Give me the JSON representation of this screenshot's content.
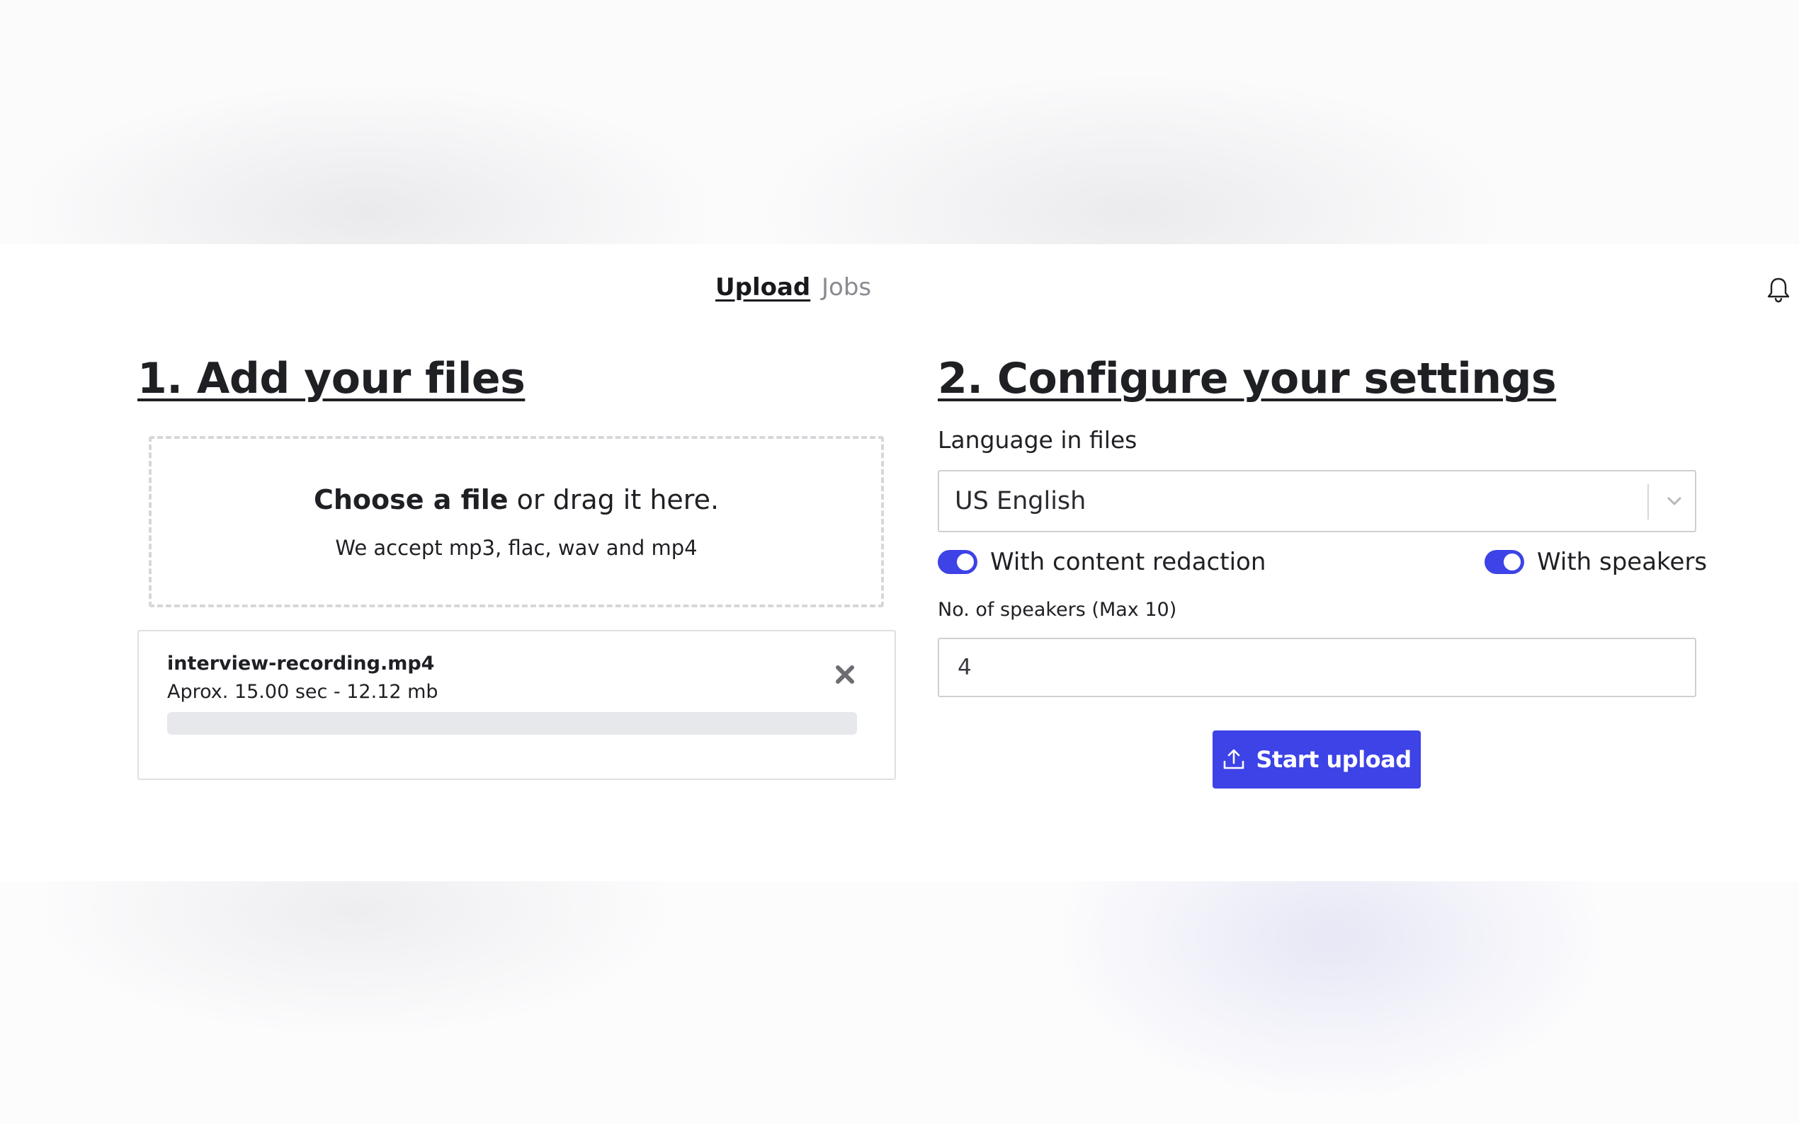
{
  "nav": {
    "tabs": [
      {
        "label": "Upload",
        "active": true
      },
      {
        "label": "Jobs",
        "active": false
      }
    ],
    "notifications_icon": "bell-icon"
  },
  "upload_section": {
    "title": "1. Add your files",
    "dropzone": {
      "choose_label": "Choose a file",
      "drag_label": " or drag it here.",
      "accepted_formats": "We accept mp3, flac, wav and mp4"
    },
    "files": [
      {
        "name": "interview-recording.mp4",
        "meta": "Aprox. 15.00 sec - 12.12 mb",
        "progress": 0
      }
    ],
    "remove_icon": "close-icon"
  },
  "settings_section": {
    "title": "2. Configure your settings",
    "language_label": "Language in files",
    "language_value": "US English",
    "toggles": [
      {
        "label": "With content redaction",
        "on": true
      },
      {
        "label": "With speakers",
        "on": true
      }
    ],
    "speakers_label": "No. of speakers (Max 10)",
    "speakers_value": "4",
    "start_button": {
      "label": "Start upload",
      "icon": "upload-icon"
    }
  },
  "colors": {
    "accent": "#3d43e6",
    "text": "#1f2024",
    "muted": "#8a8b90",
    "progress_track": "#e7e8ec"
  }
}
